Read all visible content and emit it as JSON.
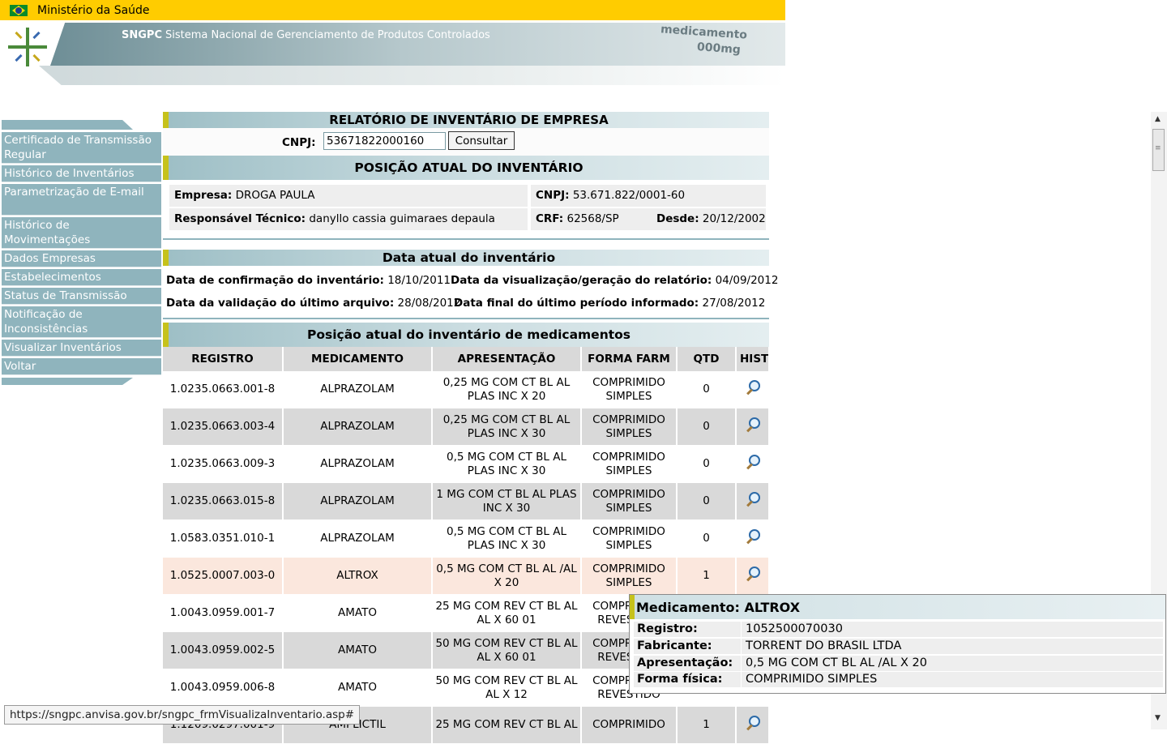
{
  "gov_bar": {
    "title": "Ministério da Saúde"
  },
  "header": {
    "brand": "SNGPC",
    "title": "Sistema Nacional de Gerenciamento de Produtos Controlados",
    "banner_med": "medicamento",
    "banner_dose": "000mg"
  },
  "sidebar": {
    "items": [
      {
        "label": "Certificado de Transmissão Regular"
      },
      {
        "label": "Histórico de Inventários"
      },
      {
        "label": "Parametrização de E-mail"
      },
      {
        "label": "Histórico de Movimentações"
      },
      {
        "label": "Dados Empresas"
      },
      {
        "label": "Estabelecimentos"
      },
      {
        "label": "Status de Transmissão"
      },
      {
        "label": "Notificação de Inconsistências"
      },
      {
        "label": "Visualizar Inventários"
      },
      {
        "label": "Voltar"
      }
    ]
  },
  "report": {
    "title": "RELATÓRIO DE INVENTÁRIO DE EMPRESA",
    "cnpj_label": "CNPJ:",
    "cnpj_value": "53671822000160",
    "consult_label": "Consultar"
  },
  "position": {
    "title": "POSIÇÃO ATUAL DO INVENTÁRIO",
    "empresa_label": "Empresa:",
    "empresa_value": "DROGA PAULA",
    "cnpj_label": "CNPJ:",
    "cnpj_value": "53.671.822/0001-60",
    "resp_label": "Responsável Técnico:",
    "resp_value": "danyllo cassia guimaraes depaula",
    "crf_label": "CRF:",
    "crf_value": "62568/SP",
    "desde_label": "Desde:",
    "desde_value": "20/12/2002"
  },
  "dates": {
    "title": "Data atual do inventário",
    "confirm_label": "Data de confirmação do inventário:",
    "confirm_value": "18/10/2011",
    "view_label": "Data da visualização/geração do relatório:",
    "view_value": "04/09/2012",
    "valid_label": "Data da validação do último arquivo:",
    "valid_value": "28/08/2012",
    "final_label": "Data final do último período informado:",
    "final_value": "27/08/2012"
  },
  "medicines": {
    "title": "Posição atual do inventário de medicamentos",
    "headers": [
      "REGISTRO",
      "MEDICAMENTO",
      "APRESENTAÇÃO",
      "FORMA FARM",
      "QTD",
      "HIST"
    ],
    "rows": [
      {
        "registro": "1.0235.0663.001-8",
        "medicamento": "ALPRAZOLAM",
        "apresentacao": "0,25 MG COM CT BL AL PLAS INC X 20",
        "forma": "COMPRIMIDO SIMPLES",
        "qtd": "0"
      },
      {
        "registro": "1.0235.0663.003-4",
        "medicamento": "ALPRAZOLAM",
        "apresentacao": "0,25 MG COM CT BL AL PLAS INC X 30",
        "forma": "COMPRIMIDO SIMPLES",
        "qtd": "0"
      },
      {
        "registro": "1.0235.0663.009-3",
        "medicamento": "ALPRAZOLAM",
        "apresentacao": "0,5 MG COM CT BL AL PLAS INC X 30",
        "forma": "COMPRIMIDO SIMPLES",
        "qtd": "0"
      },
      {
        "registro": "1.0235.0663.015-8",
        "medicamento": "ALPRAZOLAM",
        "apresentacao": "1 MG COM CT BL AL PLAS INC X 30",
        "forma": "COMPRIMIDO SIMPLES",
        "qtd": "0"
      },
      {
        "registro": "1.0583.0351.010-1",
        "medicamento": "ALPRAZOLAM",
        "apresentacao": "0,5 MG COM CT BL AL PLAS INC X 30",
        "forma": "COMPRIMIDO SIMPLES",
        "qtd": "0"
      },
      {
        "registro": "1.0525.0007.003-0",
        "medicamento": "ALTROX",
        "apresentacao": "0,5 MG COM CT BL AL /AL X 20",
        "forma": "COMPRIMIDO SIMPLES",
        "qtd": "1"
      },
      {
        "registro": "1.0043.0959.001-7",
        "medicamento": "AMATO",
        "apresentacao": "25 MG COM REV CT BL AL AL X 60 01",
        "forma": "COMPRIMIDO REVESTIDO",
        "qtd": "1"
      },
      {
        "registro": "1.0043.0959.002-5",
        "medicamento": "AMATO",
        "apresentacao": "50 MG COM REV CT BL AL AL X 60 01",
        "forma": "COMPRIMIDO REVESTIDO",
        "qtd": "1"
      },
      {
        "registro": "1.0043.0959.006-8",
        "medicamento": "AMATO",
        "apresentacao": "50 MG COM REV CT BL AL AL X 12",
        "forma": "COMPRIMIDO REVESTIDO",
        "qtd": "1"
      },
      {
        "registro": "1.1209.0297.001-9",
        "medicamento": "AMPLICTIL",
        "apresentacao": "25 MG COM REV CT BL AL",
        "forma": "COMPRIMIDO",
        "qtd": "1"
      }
    ]
  },
  "tooltip": {
    "title": "Medicamento: ALTROX",
    "registro_label": "Registro:",
    "registro_value": "1052500070030",
    "fabricante_label": "Fabricante:",
    "fabricante_value": "TORRENT DO BRASIL LTDA",
    "apresentacao_label": "Apresentação:",
    "apresentacao_value": "0,5 MG COM CT BL AL /AL X 20",
    "forma_label": "Forma física:",
    "forma_value": "COMPRIMIDO SIMPLES"
  },
  "status_bar": {
    "url": "https://sngpc.anvisa.gov.br/sngpc_frmVisualizaInventario.asp#"
  },
  "colors": {
    "ministry_yellow": "#ffcc00",
    "menu_teal": "#8fb4bd",
    "accent_olive": "#c6c21c",
    "row_gray": "#d9d9d9",
    "row_selected": "#fbe7dd"
  },
  "icons": {
    "gov_logo": "brazil-flag-icon",
    "logo": "sngpc-logo-icon",
    "hist": "magnifier-icon"
  }
}
